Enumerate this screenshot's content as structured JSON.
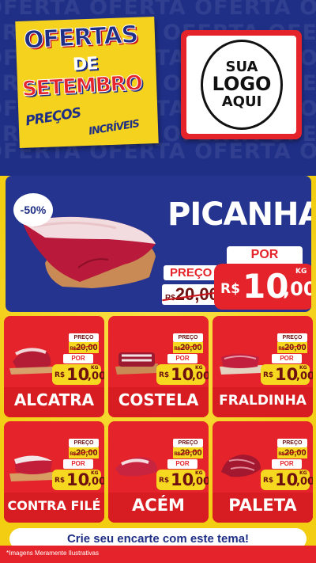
{
  "background_text": "OFERTA",
  "header": {
    "title_line1": "OFERTAS",
    "title_line2": "DE",
    "title_line3": "SETEMBRO",
    "subtitle_line1": "PREÇOS",
    "subtitle_line2": "INCRÍVEIS",
    "logo_line1": "SUA",
    "logo_line2": "LOGO",
    "logo_line3": "AQUI"
  },
  "hero": {
    "name": "PICANHA",
    "discount_badge": "-50%",
    "old_price_label": "PREÇO",
    "old_price_currency": "R$",
    "old_price_value": "20,00",
    "new_price_label": "POR",
    "new_price_currency": "R$",
    "new_price_int": "10",
    "new_price_dec": ",00",
    "unit": "KG"
  },
  "products": [
    {
      "name": "ALCATRA",
      "old_label": "PREÇO",
      "old_currency": "R$",
      "old_value": "20,00",
      "por_label": "POR",
      "currency": "R$",
      "price_int": "10",
      "price_dec": ",00",
      "unit": "KG"
    },
    {
      "name": "COSTELA",
      "old_label": "PREÇO",
      "old_currency": "R$",
      "old_value": "20,00",
      "por_label": "POR",
      "currency": "R$",
      "price_int": "10",
      "price_dec": ",00",
      "unit": "KG"
    },
    {
      "name": "FRALDINHA",
      "old_label": "PREÇO",
      "old_currency": "R$",
      "old_value": "20,00",
      "por_label": "POR",
      "currency": "R$",
      "price_int": "10",
      "price_dec": ",00",
      "unit": "KG"
    },
    {
      "name": "CONTRA FILÉ",
      "old_label": "PREÇO",
      "old_currency": "R$",
      "old_value": "20,00",
      "por_label": "POR",
      "currency": "R$",
      "price_int": "10",
      "price_dec": ",00",
      "unit": "KG"
    },
    {
      "name": "ACÉM",
      "old_label": "PREÇO",
      "old_currency": "R$",
      "old_value": "20,00",
      "por_label": "POR",
      "currency": "R$",
      "price_int": "10",
      "price_dec": ",00",
      "unit": "KG"
    },
    {
      "name": "PALETA",
      "old_label": "PREÇO",
      "old_currency": "R$",
      "old_value": "20,00",
      "por_label": "POR",
      "currency": "R$",
      "price_int": "10",
      "price_dec": ",00",
      "unit": "KG"
    }
  ],
  "cta": "Crie seu encarte com este tema!",
  "footnote": "*Imagens Meramente Ilustrativas",
  "colors": {
    "navy": "#1f2f86",
    "red": "#e4242a",
    "yellow": "#f6d820",
    "white": "#ffffff"
  }
}
